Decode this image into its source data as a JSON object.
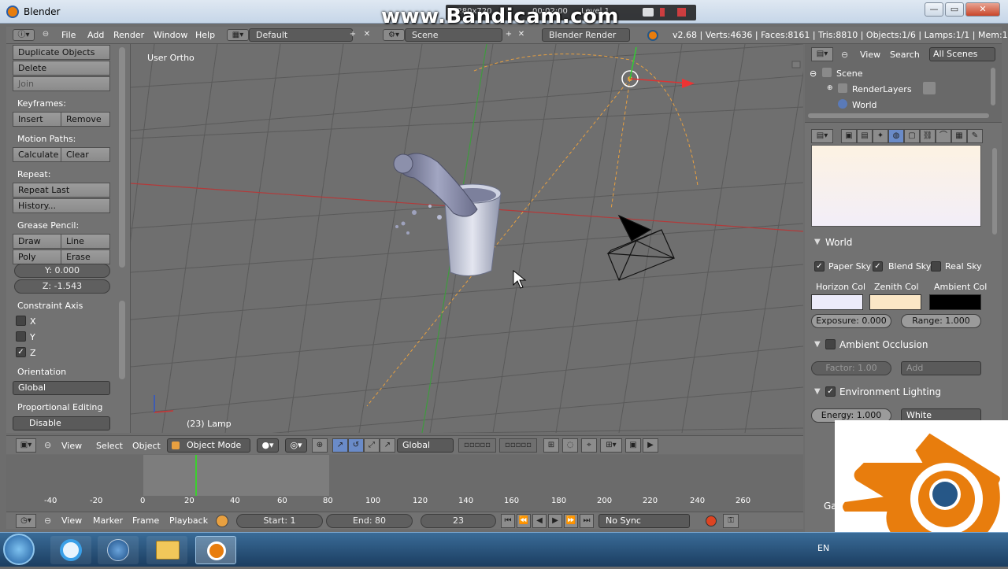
{
  "window": {
    "title": "Blender",
    "min": "—",
    "max": "▭",
    "close": "✕"
  },
  "watermark": "www.Bandicam.com",
  "recorder": {
    "resolution": "1280x720",
    "time": "00:02:00",
    "extra": "Level 1"
  },
  "header": {
    "menus": [
      "File",
      "Add",
      "Render",
      "Window",
      "Help"
    ],
    "layout": "Default",
    "scene": "Scene",
    "engine": "Blender Render",
    "stats": "v2.68 | Verts:4636 | Faces:8161 | Tris:8810 | Objects:1/6 | Lamps:1/1 | Mem:15.55M"
  },
  "toolshelf": {
    "top_buttons": [
      "Duplicate Objects",
      "Delete",
      "Join"
    ],
    "keyframes_label": "Keyframes:",
    "keyframes": [
      "Insert",
      "Remove"
    ],
    "motion_label": "Motion Paths:",
    "motion": [
      "Calculate",
      "Clear"
    ],
    "repeat_label": "Repeat:",
    "repeat": [
      "Repeat Last",
      "History..."
    ],
    "grease_label": "Grease Pencil:",
    "grease": [
      "Draw",
      "Line",
      "Poly",
      "Erase"
    ],
    "y_field": "Y: 0.000",
    "z_field": "Z: -1.543",
    "constraint_label": "Constraint Axis",
    "axes": [
      "X",
      "Y",
      "Z"
    ],
    "orientation_label": "Orientation",
    "orientation": "Global",
    "proportional_label": "Proportional Editing",
    "proportional": "Disable"
  },
  "viewport": {
    "view_label": "User Ortho",
    "object_label": "(23) Lamp"
  },
  "v3d_header": {
    "menus": [
      "View",
      "Select",
      "Object"
    ],
    "mode": "Object Mode",
    "orientation": "Global"
  },
  "timeline": {
    "ticks": [
      "-40",
      "-20",
      "0",
      "20",
      "40",
      "60",
      "80",
      "100",
      "120",
      "140",
      "160",
      "180",
      "200",
      "220",
      "240",
      "260"
    ],
    "menus": [
      "View",
      "Marker",
      "Frame",
      "Playback"
    ],
    "start": "Start: 1",
    "end": "End: 80",
    "current": "23",
    "sync": "No Sync"
  },
  "outliner": {
    "menus": [
      "View",
      "Search"
    ],
    "filter": "All Scenes",
    "items": [
      "Scene",
      "RenderLayers",
      "World"
    ]
  },
  "properties": {
    "world_label": "World",
    "sky_checks": [
      "Paper Sky",
      "Blend Sky",
      "Real Sky"
    ],
    "color_labels": [
      "Horizon Col",
      "Zenith Col",
      "Ambient Col"
    ],
    "colors": {
      "horizon": "#ecebfa",
      "zenith": "#fbe7c6",
      "ambient": "#000000"
    },
    "exposure": "Exposure: 0.000",
    "range": "Range: 1.000",
    "ao_label": "Ambient Occlusion",
    "factor": "Factor: 1.00",
    "add": "Add",
    "env_label": "Environment Lighting",
    "energy": "Energy: 1.000",
    "env_color": "White",
    "partial_g": "Ga"
  },
  "taskbar": {
    "lang": "EN"
  },
  "accent": {
    "blender_orange": "#e87d0d",
    "blender_blue": "#265787",
    "timeline_cursor": "#3ccf2f"
  }
}
